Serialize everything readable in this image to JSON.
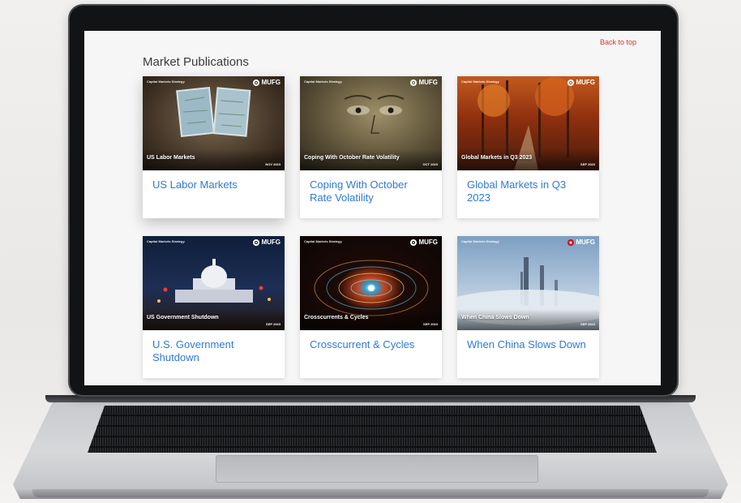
{
  "page": {
    "back_to_top": "Back to top",
    "section_title": "Market Publications"
  },
  "cards": [
    {
      "title": "US Labor Markets",
      "cover_series": "Capital Markets Strategy",
      "cover_title": "US Labor Markets",
      "cover_date": "NOV 2023",
      "logo": "MUFG"
    },
    {
      "title": "Coping With October Rate Volatility",
      "cover_series": "Capital Markets Strategy",
      "cover_title": "Coping With October Rate Volatility",
      "cover_date": "OCT 2023",
      "logo": "MUFG"
    },
    {
      "title": "Global Markets in Q3 2023",
      "cover_series": "Capital Markets Strategy",
      "cover_title": "Global Markets in Q3 2023",
      "cover_date": "SEP 2023",
      "logo": "MUFG"
    },
    {
      "title": "U.S. Government Shutdown",
      "cover_series": "Capital Markets Strategy",
      "cover_title": "US Government Shutdown",
      "cover_date": "SEP 2023",
      "logo": "MUFG"
    },
    {
      "title": "Crosscurrent & Cycles",
      "cover_series": "Capital Markets Strategy",
      "cover_title": "Crosscurrents & Cycles",
      "cover_date": "SEP 2023",
      "logo": "MUFG"
    },
    {
      "title": "When China Slows Down",
      "cover_series": "Capital Markets Strategy",
      "cover_title": "When China Slows Down",
      "cover_date": "SEP 2023",
      "logo": "MUFG"
    }
  ],
  "colors": {
    "link": "#2f7ad6",
    "back_to_top": "#d4332e",
    "logo_accent": "#e60012"
  }
}
